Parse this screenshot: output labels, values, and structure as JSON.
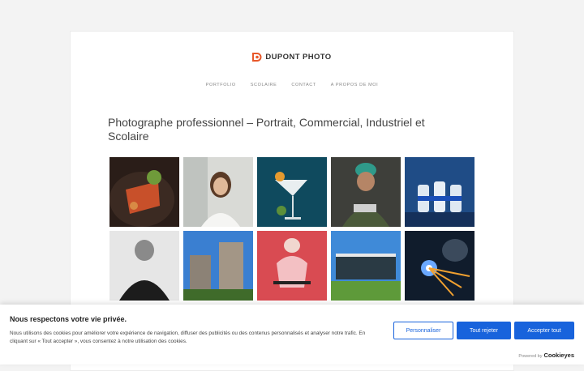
{
  "site": {
    "logo_text": "DUPONT PHOTO",
    "brand_color": "#e8582a",
    "nav": [
      {
        "label": "PORTFOLIO"
      },
      {
        "label": "SCOLAIRE"
      },
      {
        "label": "CONTACT"
      },
      {
        "label": "A PROPOS DE MOI"
      }
    ],
    "heading": "Photographe professionnel – Portrait, Commercial, Industriel et Scolaire"
  },
  "gallery": {
    "rows_visible": 2,
    "photos": [
      {
        "subject": "plated-food"
      },
      {
        "subject": "businesswoman-portrait"
      },
      {
        "subject": "cocktail-glass"
      },
      {
        "subject": "industrial-worker"
      },
      {
        "subject": "product-bottles"
      },
      {
        "subject": "bw-portrait-man"
      },
      {
        "subject": "high-rise-building"
      },
      {
        "subject": "cyclist"
      },
      {
        "subject": "modern-building"
      },
      {
        "subject": "welding-sparks"
      }
    ]
  },
  "cookie_banner": {
    "title": "Nous respectons votre vie privée.",
    "text": "Nous utilisons des cookies pour améliorer votre expérience de navigation, diffuser des publicités ou des contenus personnalisés et analyser notre trafic. En cliquant sur « Tout accepter », vous consentez à notre utilisation des cookies.",
    "customize_label": "Personnaliser",
    "reject_label": "Tout rejeter",
    "accept_label": "Accepter tout",
    "powered_by": "Powered by",
    "powered_brand": "Cookieyes",
    "accent_color": "#1863dc"
  }
}
